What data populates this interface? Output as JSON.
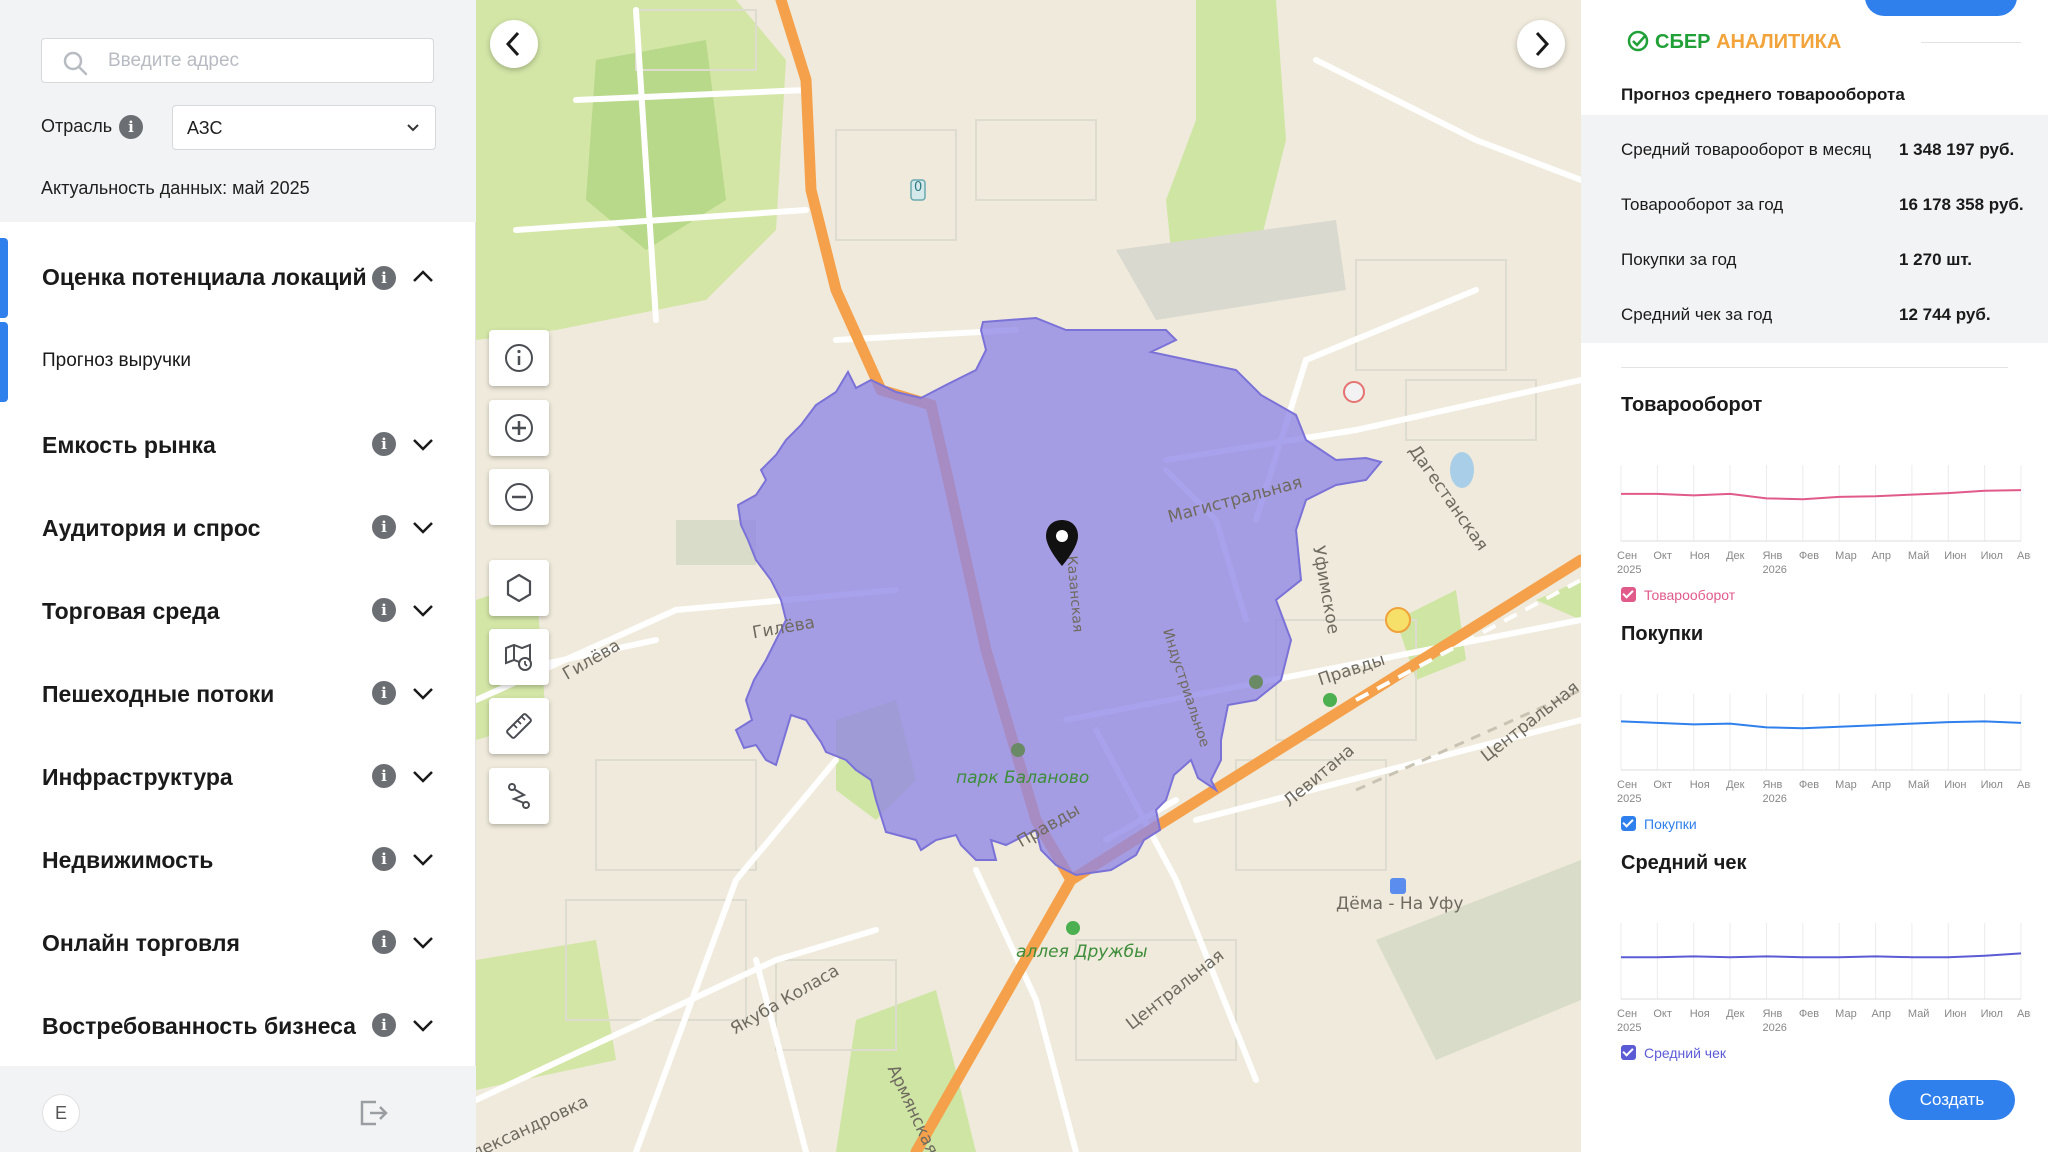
{
  "sidebar": {
    "search_placeholder": "Введите адрес",
    "industry_label": "Отрасль",
    "industry_value": "АЗС",
    "freshness": "Актуальность данных: май 2025",
    "sections": [
      {
        "title": "Оценка потенциала локаций",
        "expanded": true
      },
      {
        "title": "Емкость рынка"
      },
      {
        "title": "Аудитория и спрос"
      },
      {
        "title": "Торговая среда"
      },
      {
        "title": "Пешеходные потоки"
      },
      {
        "title": "Инфраструктура"
      },
      {
        "title": "Недвижимость"
      },
      {
        "title": "Онлайн торговля"
      },
      {
        "title": "Востребованность бизнеса"
      }
    ],
    "subitem": "Прогноз выручки",
    "avatar_initial": "E"
  },
  "map": {
    "labels": {
      "gileva1": "Гилёва",
      "gileva2": "Гилёва",
      "magistralnaya": "Магистральная",
      "dagestanskaya": "Дагестанская",
      "ufimskoe": "Уфимское",
      "pravdy1": "Правды",
      "pravdy2": "Правды",
      "park": "парк Баланово",
      "aleya": "аллея Дружбы",
      "levitana": "Левитана",
      "tsentralnaya1": "Центральная",
      "tsentralnaya2": "Центральная",
      "dema": "Дёма - На Уфу",
      "yakuba": "Якуба Коласа",
      "armyanskaya": "Армянская",
      "aleksandrovka": "Александровка",
      "kazanskaya": "Казанская",
      "industrialnoe": "Индустриальное",
      "road_number": "0"
    },
    "colors": {
      "isochrone": "#8f86e6",
      "main_road": "#f5a04a",
      "park": "#cfe5a4"
    },
    "tools": [
      "info-icon",
      "zoom-in-icon",
      "zoom-out-icon",
      "hexagon-icon",
      "map-history-icon",
      "ruler-icon",
      "route-icon"
    ]
  },
  "panel": {
    "brand_sber": "СБЕР",
    "brand_analytics": "АНАЛИТИКА",
    "forecast_title": "Прогноз среднего товарооборота",
    "metrics": [
      {
        "label": "Средний товарооборот в месяц",
        "value": "1 348 197 руб."
      },
      {
        "label": "Товарооборот за год",
        "value": "16 178 358 руб."
      },
      {
        "label": "Покупки за год",
        "value": "1 270 шт."
      },
      {
        "label": "Средний чек за год",
        "value": "12 744 руб."
      }
    ],
    "charts": [
      {
        "title": "Товарооборот",
        "legend": "Товарооборот",
        "color": "#e05a8a"
      },
      {
        "title": "Покупки",
        "legend": "Покупки",
        "color": "#2f80ed"
      },
      {
        "title": "Средний чек",
        "legend": "Средний чек",
        "color": "#5b5bd6"
      }
    ],
    "create_label": "Создать"
  },
  "chart_data": [
    {
      "type": "line",
      "title": "Товарооборот",
      "categories": [
        "Сен 2025",
        "Окт",
        "Ноя",
        "Дек",
        "Янв 2026",
        "Фев",
        "Мар",
        "Апр",
        "Май",
        "Июн",
        "Июл",
        "Авг"
      ],
      "series": [
        {
          "name": "Товарооборот",
          "values": [
            0.62,
            0.62,
            0.6,
            0.62,
            0.56,
            0.55,
            0.58,
            0.59,
            0.61,
            0.63,
            0.66,
            0.67
          ]
        }
      ],
      "ylim": [
        0,
        1
      ]
    },
    {
      "type": "line",
      "title": "Покупки",
      "categories": [
        "Сен 2025",
        "Окт",
        "Ноя",
        "Дек",
        "Янв 2026",
        "Фев",
        "Мар",
        "Апр",
        "Май",
        "Июн",
        "Июл",
        "Авг"
      ],
      "series": [
        {
          "name": "Покупки",
          "values": [
            0.64,
            0.62,
            0.6,
            0.61,
            0.56,
            0.55,
            0.57,
            0.59,
            0.61,
            0.63,
            0.64,
            0.62
          ]
        }
      ],
      "ylim": [
        0,
        1
      ]
    },
    {
      "type": "line",
      "title": "Средний чек",
      "categories": [
        "Сен 2025",
        "Окт",
        "Ноя",
        "Дек",
        "Янв 2026",
        "Фев",
        "Мар",
        "Апр",
        "Май",
        "Июн",
        "Июл",
        "Авг"
      ],
      "series": [
        {
          "name": "Средний чек",
          "values": [
            0.55,
            0.55,
            0.56,
            0.55,
            0.56,
            0.55,
            0.55,
            0.56,
            0.55,
            0.55,
            0.57,
            0.6
          ]
        }
      ],
      "ylim": [
        0,
        1
      ]
    }
  ]
}
